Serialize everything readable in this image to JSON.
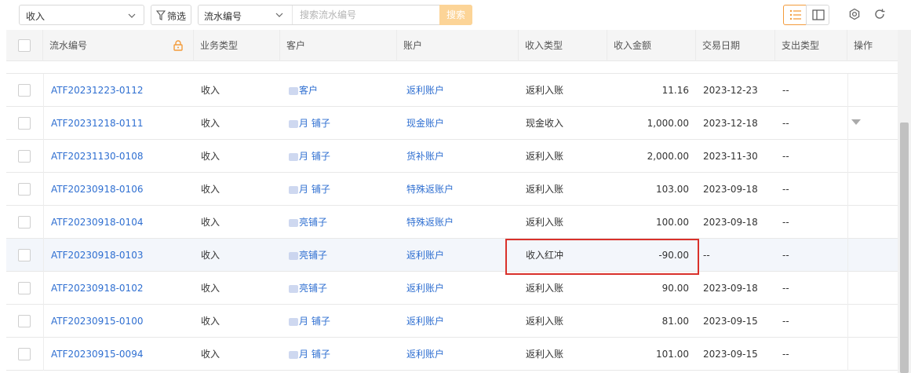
{
  "toolbar": {
    "type_select": "收入",
    "filter_label": "筛选",
    "search_field": "流水编号",
    "search_placeholder": "搜索流水编号",
    "search_button": "搜索"
  },
  "columns": [
    "流水编号",
    "业务类型",
    "客户",
    "账户",
    "收入类型",
    "收入金额",
    "交易日期",
    "支出类型",
    "操作"
  ],
  "rows": [
    {
      "id": "ATF20231223-0112",
      "biz": "收入",
      "cust": "客户",
      "acct": "返利账户",
      "itype": "返利入账",
      "amount": "11.16",
      "date": "2023-12-23",
      "etype": "--"
    },
    {
      "id": "ATF20231218-0111",
      "biz": "收入",
      "cust": "月 铺子",
      "acct": "现金账户",
      "itype": "现金收入",
      "amount": "1,000.00",
      "date": "2023-12-18",
      "etype": "--"
    },
    {
      "id": "ATF20231130-0108",
      "biz": "收入",
      "cust": "月 铺子",
      "acct": "货补账户",
      "itype": "返利入账",
      "amount": "2,000.00",
      "date": "2023-11-30",
      "etype": "--"
    },
    {
      "id": "ATF20230918-0106",
      "biz": "收入",
      "cust": "月 铺子",
      "acct": "特殊返账户",
      "itype": "返利入账",
      "amount": "103.00",
      "date": "2023-09-18",
      "etype": "--"
    },
    {
      "id": "ATF20230918-0104",
      "biz": "收入",
      "cust": "亮铺子",
      "acct": "特殊返账户",
      "itype": "返利入账",
      "amount": "100.00",
      "date": "2023-09-18",
      "etype": "--"
    },
    {
      "id": "ATF20230918-0103",
      "biz": "收入",
      "cust": "亮铺子",
      "acct": "返利账户",
      "itype": "收入红冲",
      "amount": "-90.00",
      "date": "--",
      "etype": "--"
    },
    {
      "id": "ATF20230918-0102",
      "biz": "收入",
      "cust": "亮铺子",
      "acct": "返利账户",
      "itype": "返利入账",
      "amount": "90.00",
      "date": "2023-09-18",
      "etype": "--"
    },
    {
      "id": "ATF20230915-0100",
      "biz": "收入",
      "cust": "月 铺子",
      "acct": "返利账户",
      "itype": "返利入账",
      "amount": "81.00",
      "date": "2023-09-15",
      "etype": "--"
    },
    {
      "id": "ATF20230915-0094",
      "biz": "收入",
      "cust": "月 铺子",
      "acct": "返利账户",
      "itype": "返利入账",
      "amount": "101.00",
      "date": "2023-09-15",
      "etype": "--"
    }
  ],
  "colors": {
    "accent": "#f39b3b",
    "link": "#2f6fd1",
    "highlight_box": "#d9312b",
    "search_button": "#fcd497"
  }
}
